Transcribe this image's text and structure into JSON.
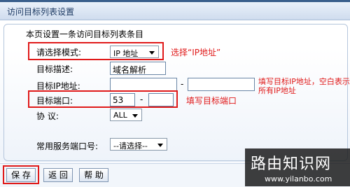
{
  "header": {
    "title": "访问目标列表设置"
  },
  "form": {
    "description": "本页设置一条访问目标列表条目",
    "mode": {
      "label": "请选择模式:",
      "value": "IP 地址"
    },
    "target_desc": {
      "label": "目标描述:",
      "value": "域名解析"
    },
    "target_ip": {
      "label": "目标IP地址:",
      "start": "",
      "end": "",
      "sep": "-"
    },
    "target_port": {
      "label": "目标端口:",
      "start": "53",
      "end": "",
      "sep": "-"
    },
    "protocol": {
      "label": "协  议:",
      "value": "ALL"
    },
    "common_port": {
      "label": "常用服务端口号:",
      "value": "--请选择--"
    }
  },
  "annotations": {
    "mode": "选择“IP地址”",
    "ip": "填写目标IP地址，空白表示所有IP地址",
    "port": "填写目标端口"
  },
  "buttons": {
    "save": "保 存",
    "back": "返 回",
    "help": "帮 助"
  },
  "watermark": {
    "site": "路由知识网",
    "url": "www.yilanbo.com"
  },
  "colors": {
    "annotation": "#e01a1a",
    "title_text": "#1d3a63"
  }
}
